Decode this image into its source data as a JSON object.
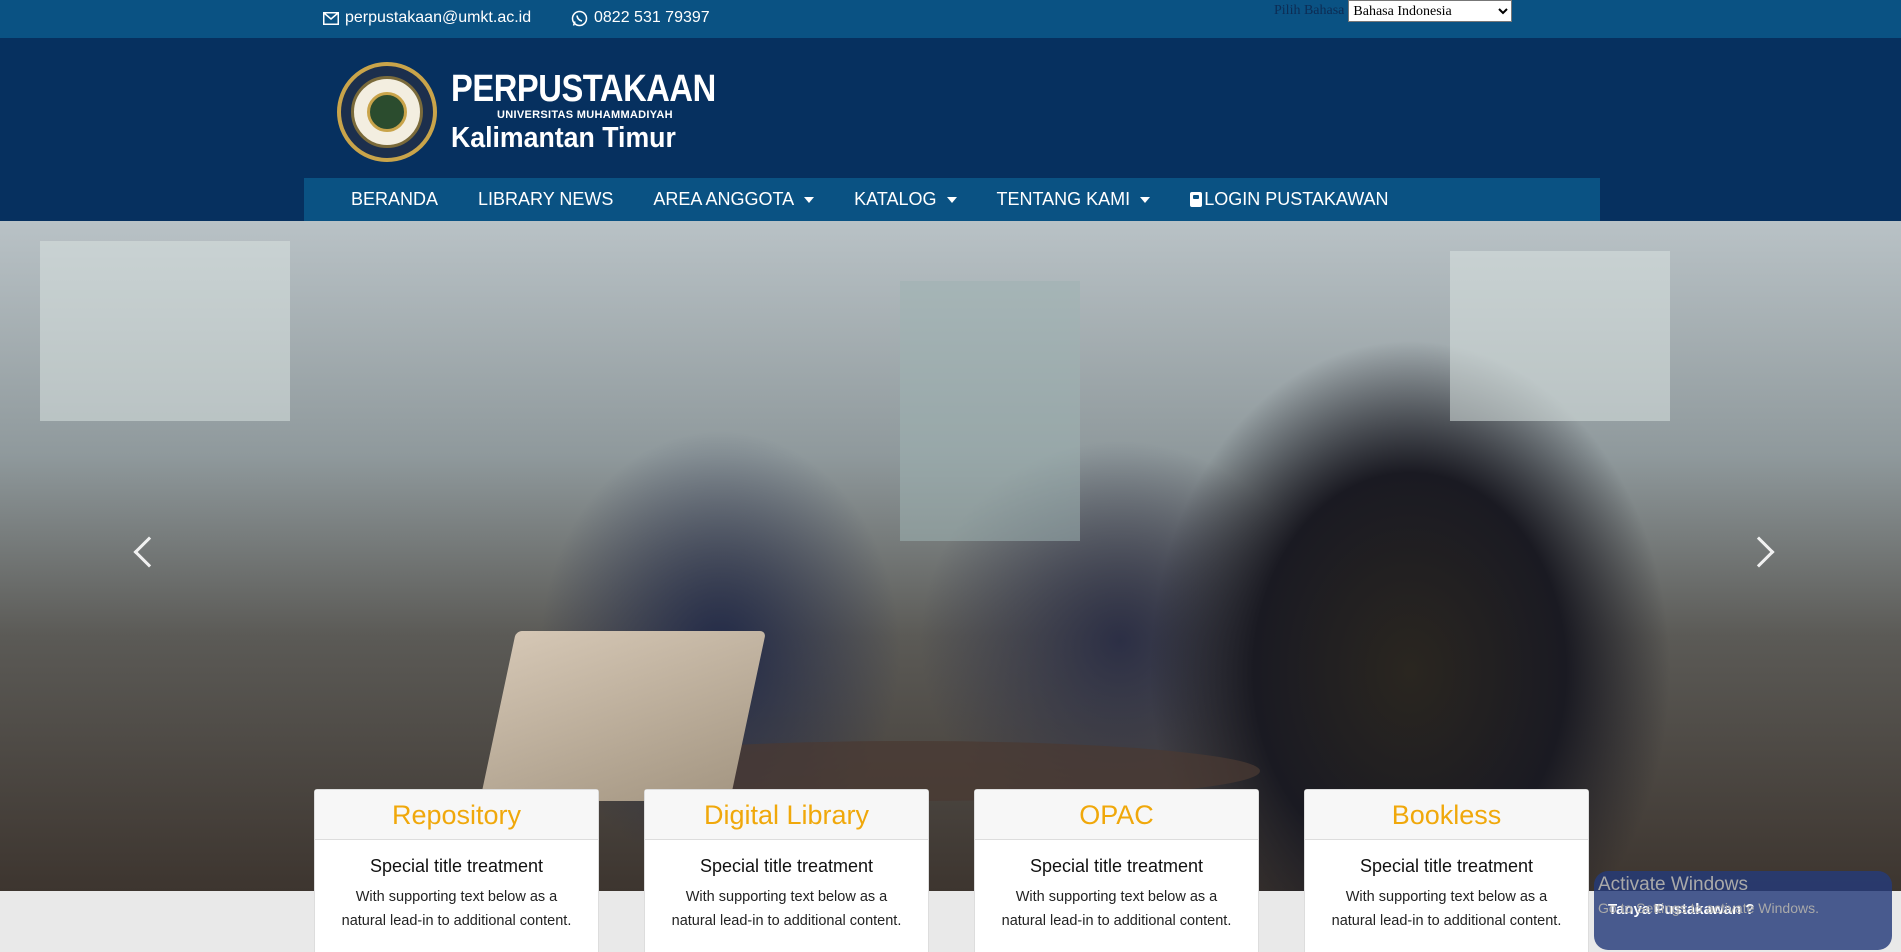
{
  "topbar": {
    "email": "perpustakaan@umkt.ac.id",
    "phone": "0822 531 79397",
    "language_label": "Pilih Bahasa",
    "language_selected": "Bahasa Indonesia"
  },
  "logo": {
    "line1": "PERPUSTAKAAN",
    "line2": "UNIVERSITAS MUHAMMADIYAH",
    "line3": "Kalimantan Timur"
  },
  "nav": {
    "items": [
      {
        "label": "BERANDA"
      },
      {
        "label": "LIBRARY NEWS"
      },
      {
        "label": "AREA ANGGOTA"
      },
      {
        "label": "KATALOG"
      },
      {
        "label": "TENTANG KAMI"
      },
      {
        "label": "LOGIN PUSTAKAWAN"
      }
    ]
  },
  "cards": [
    {
      "header": "Repository",
      "title": "Special title treatment",
      "text": "With supporting text below as a natural lead-in to additional content."
    },
    {
      "header": "Digital Library",
      "title": "Special title treatment",
      "text": "With supporting text below as a natural lead-in to additional content."
    },
    {
      "header": "OPAC",
      "title": "Special title treatment",
      "text": "With supporting text below as a natural lead-in to additional content."
    },
    {
      "header": "Bookless",
      "title": "Special title treatment",
      "text": "With supporting text below as a natural lead-in to additional content."
    }
  ],
  "watermark": {
    "line1": "Activate Windows",
    "line2": "Go to Settings to activate Windows."
  },
  "chat": {
    "label": "Tanya Pustakawan ?"
  },
  "colors": {
    "topbar": "#0a5283",
    "header": "#06305f",
    "card_header_text": "#f0a80b"
  },
  "icons": [
    "envelope-icon",
    "whatsapp-icon",
    "lock-icon",
    "chevron-left-icon",
    "chevron-right-icon"
  ]
}
